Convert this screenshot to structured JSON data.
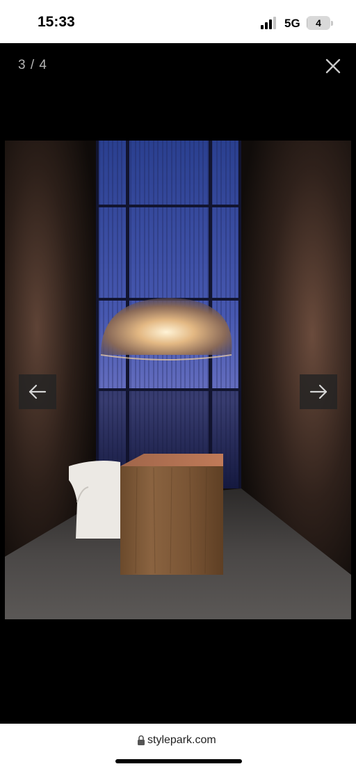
{
  "status_bar": {
    "time": "15:33",
    "network": "5G",
    "battery": "4",
    "battery_level": 0.04
  },
  "viewer": {
    "counter": "3 / 4",
    "prev_arrow": "←",
    "next_arrow": "→"
  },
  "browser": {
    "url": "stylepark.com"
  },
  "icons": {
    "signal": "signal-bars-icon",
    "lock": "lock-icon",
    "close": "close-icon",
    "prev": "arrow-left-icon",
    "next": "arrow-right-icon"
  },
  "colors": {
    "background": "#000000",
    "status_bar": "#ffffff",
    "control_bg": "#232323"
  }
}
